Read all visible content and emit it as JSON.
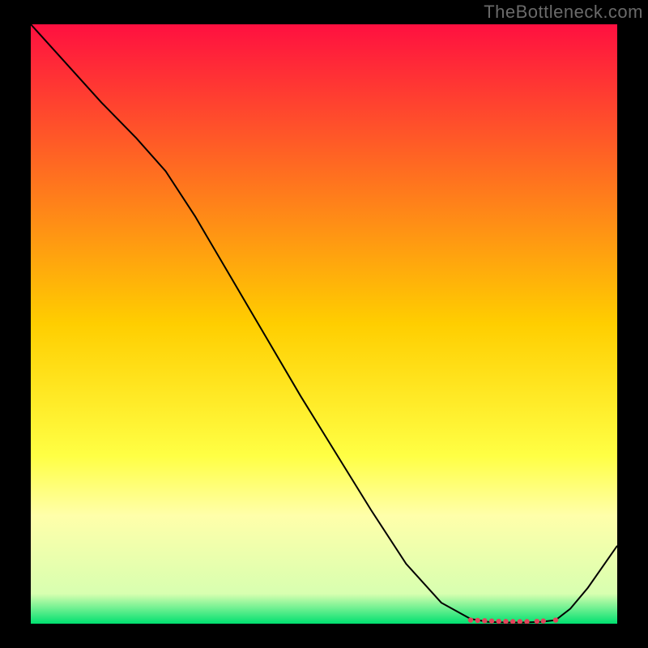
{
  "watermark": "TheBottleneck.com",
  "chart_data": {
    "type": "line",
    "title": "",
    "xlabel": "",
    "ylabel": "",
    "xlim": [
      0,
      100
    ],
    "ylim": [
      0,
      100
    ],
    "grid": false,
    "legend": false,
    "background_gradient": {
      "stops": [
        {
          "offset": 0.0,
          "color": "#ff1040"
        },
        {
          "offset": 0.5,
          "color": "#ffce00"
        },
        {
          "offset": 0.72,
          "color": "#ffff44"
        },
        {
          "offset": 0.82,
          "color": "#ffffaa"
        },
        {
          "offset": 0.95,
          "color": "#d8ffb0"
        },
        {
          "offset": 1.0,
          "color": "#00e070"
        }
      ]
    },
    "series": [
      {
        "name": "curve",
        "color": "#000000",
        "width": 2,
        "x": [
          0,
          6,
          12,
          18,
          23,
          28,
          34,
          40,
          46,
          52,
          58,
          64,
          70,
          75,
          78,
          81,
          84,
          87,
          89.5,
          92,
          95,
          100
        ],
        "y": [
          100,
          93.5,
          87,
          81,
          75.5,
          68,
          58,
          48,
          38,
          28.5,
          19,
          10,
          3.5,
          0.8,
          0.3,
          0.2,
          0.2,
          0.3,
          0.6,
          2.5,
          6,
          13
        ]
      }
    ],
    "markers": {
      "name": "baseline-dots",
      "color": "#e2435a",
      "radius": 3.2,
      "points": [
        {
          "x": 75.0,
          "y": 0.6
        },
        {
          "x": 76.2,
          "y": 0.55
        },
        {
          "x": 77.4,
          "y": 0.5
        },
        {
          "x": 78.6,
          "y": 0.45
        },
        {
          "x": 79.8,
          "y": 0.4
        },
        {
          "x": 81.0,
          "y": 0.38
        },
        {
          "x": 82.2,
          "y": 0.36
        },
        {
          "x": 83.4,
          "y": 0.35
        },
        {
          "x": 84.6,
          "y": 0.36
        },
        {
          "x": 86.3,
          "y": 0.4
        },
        {
          "x": 87.4,
          "y": 0.45
        },
        {
          "x": 89.5,
          "y": 0.6
        }
      ]
    }
  }
}
